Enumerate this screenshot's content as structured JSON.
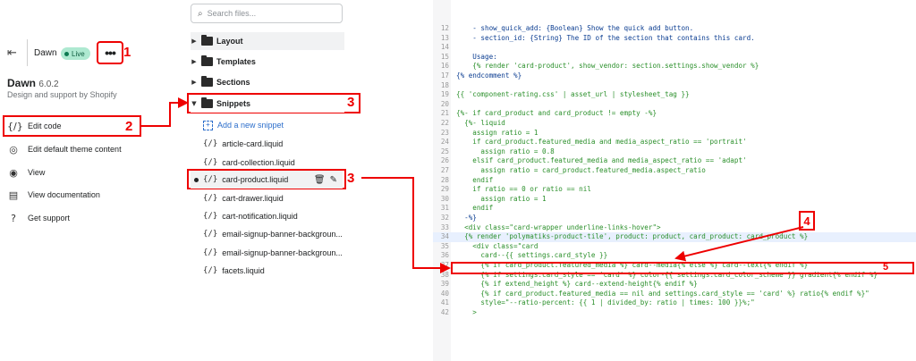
{
  "left_panel": {
    "theme_name": "Dawn",
    "live_label": "Live",
    "more_label": "•••",
    "title": "Dawn",
    "version": "6.0.2",
    "subtitle": "Design and support by Shopify",
    "menu": [
      {
        "icon": "{/}",
        "label": "Edit code"
      },
      {
        "icon": "◎",
        "label": "Edit default theme content"
      },
      {
        "icon": "◉",
        "label": "View"
      },
      {
        "icon": "▤",
        "label": "View documentation"
      },
      {
        "icon": "?",
        "label": "Get support"
      }
    ]
  },
  "file_tree": {
    "search_placeholder": "Search files...",
    "folders": [
      "Layout",
      "Templates",
      "Sections",
      "Snippets"
    ],
    "add_snippet": "Add a new snippet",
    "files": [
      "article-card.liquid",
      "card-collection.liquid",
      "card-product.liquid",
      "cart-drawer.liquid",
      "cart-notification.liquid",
      "email-signup-banner-backgroun...",
      "email-signup-banner-backgroun...",
      "facets.liquid"
    ]
  },
  "annotations": [
    "1",
    "2",
    "3",
    "3",
    "4",
    "5"
  ],
  "code": [
    {
      "n": "12",
      "t": "    - show_quick_add: {Boolean} Show the quick add button."
    },
    {
      "n": "13",
      "t": "    - section_id: {String} The ID of the section that contains this card."
    },
    {
      "n": "14",
      "t": ""
    },
    {
      "n": "15",
      "t": "    Usage:"
    },
    {
      "n": "16",
      "t": "    {% render 'card-product', show_vendor: section.settings.show_vendor %}"
    },
    {
      "n": "17",
      "t": "{% endcomment %}"
    },
    {
      "n": "18",
      "t": ""
    },
    {
      "n": "19",
      "t": "{{ 'component-rating.css' | asset_url | stylesheet_tag }}"
    },
    {
      "n": "20",
      "t": ""
    },
    {
      "n": "21",
      "t": "{%- if card_product and card_product != empty -%}"
    },
    {
      "n": "22",
      "t": "  {%- liquid"
    },
    {
      "n": "23",
      "t": "    assign ratio = 1"
    },
    {
      "n": "24",
      "t": "    if card_product.featured_media and media_aspect_ratio == 'portrait'"
    },
    {
      "n": "25",
      "t": "      assign ratio = 0.8"
    },
    {
      "n": "26",
      "t": "    elsif card_product.featured_media and media_aspect_ratio == 'adapt'"
    },
    {
      "n": "27",
      "t": "      assign ratio = card_product.featured_media.aspect_ratio"
    },
    {
      "n": "28",
      "t": "    endif"
    },
    {
      "n": "29",
      "t": "    if ratio == 0 or ratio == nil"
    },
    {
      "n": "30",
      "t": "      assign ratio = 1"
    },
    {
      "n": "31",
      "t": "    endif"
    },
    {
      "n": "32",
      "t": "  -%}"
    },
    {
      "n": "33",
      "t": "  <div class=\"card-wrapper underline-links-hover\">"
    },
    {
      "n": "34",
      "t": "  {% render 'polymatiks-product-tile', product: product, card_product: card_product %}"
    },
    {
      "n": "35",
      "t": "    <div class=\"card"
    },
    {
      "n": "36",
      "t": "      card--{{ settings.card_style }}"
    },
    {
      "n": "37",
      "t": "      {% if card_product.featured_media %} card--media{% else %} card--text{% endif %}"
    },
    {
      "n": "38",
      "t": "      {% if settings.card_style == 'card' %} color-{{ settings.card_color_scheme }} gradient{% endif %}"
    },
    {
      "n": "39",
      "t": "      {% if extend_height %} card--extend-height{% endif %}"
    },
    {
      "n": "40",
      "t": "      {% if card_product.featured_media == nil and settings.card_style == 'card' %} ratio{% endif %}\""
    },
    {
      "n": "41",
      "t": "      style=\"--ratio-percent: {{ 1 | divided_by: ratio | times: 100 }}%;\""
    },
    {
      "n": "42",
      "t": "    >"
    }
  ],
  "colors": {
    "annotation": "#e00000",
    "accent_link": "#2c6ecb",
    "live_bg": "#aee9d1"
  }
}
